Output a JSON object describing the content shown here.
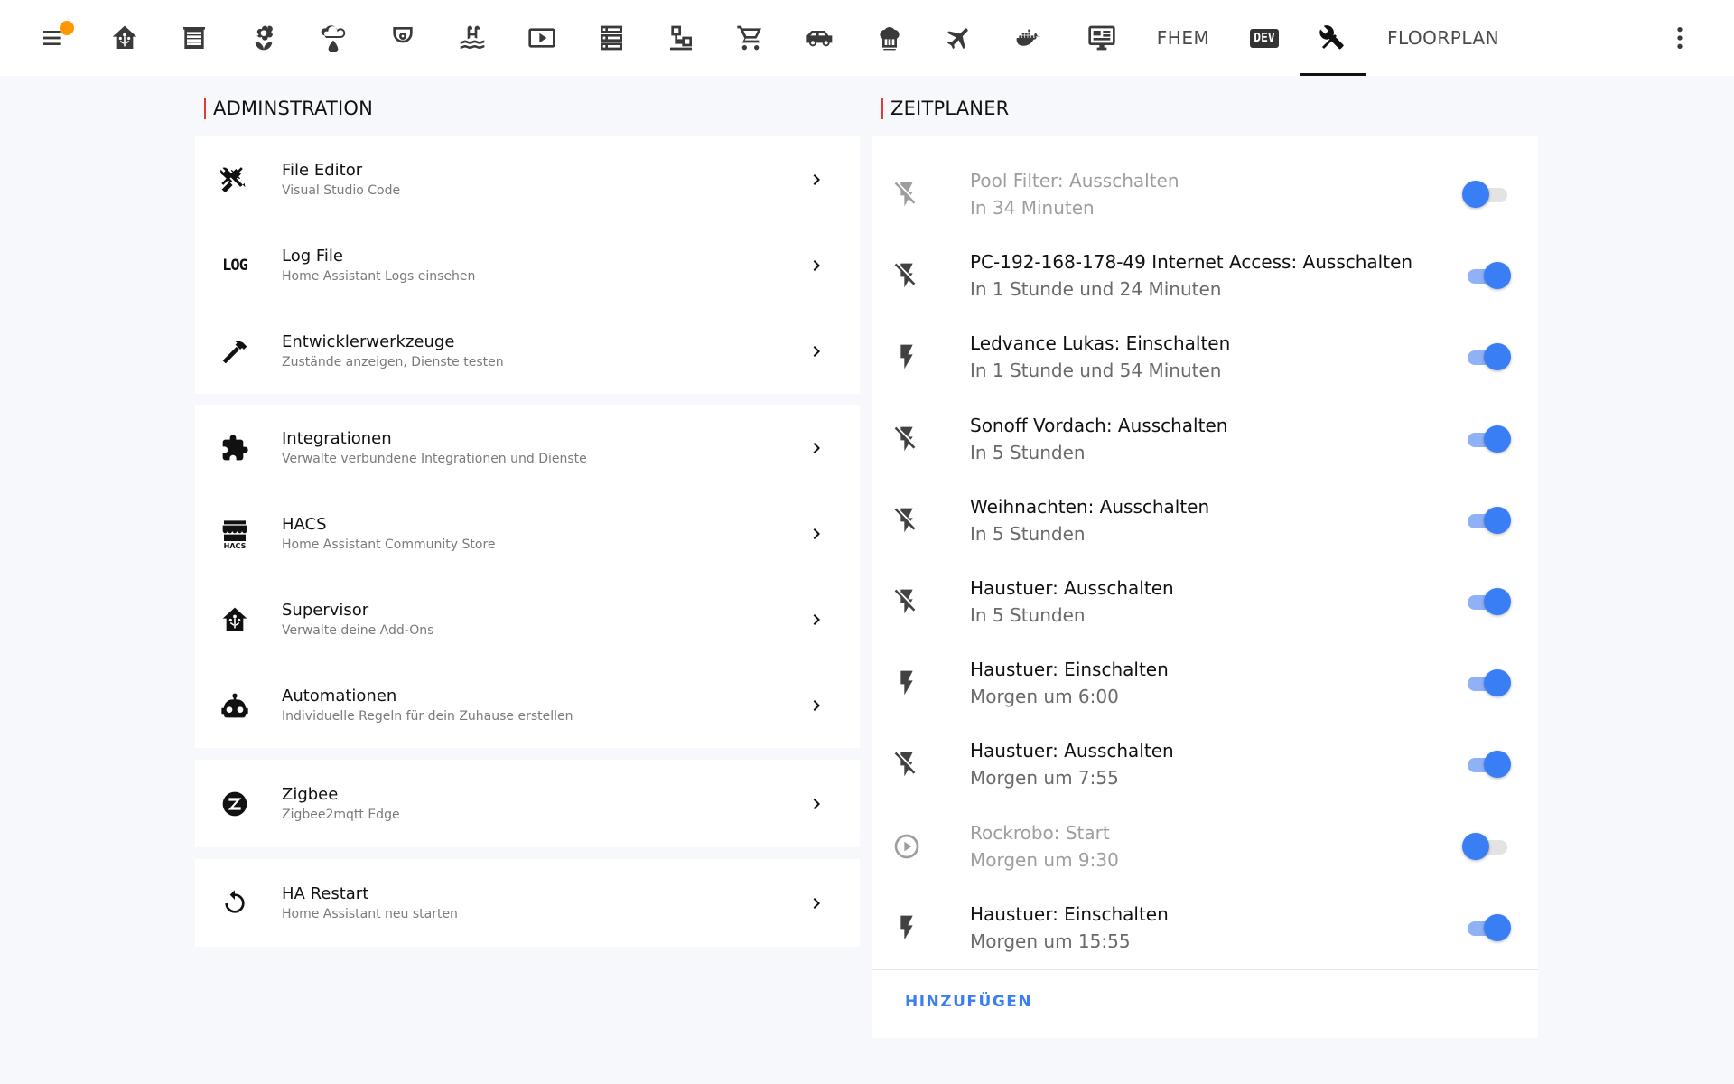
{
  "topbar": {
    "tabs": [
      {
        "icon": "menu-icon"
      },
      {
        "icon": "home-assistant-icon"
      },
      {
        "icon": "garage-icon"
      },
      {
        "icon": "flower-icon"
      },
      {
        "icon": "sprinkler-icon"
      },
      {
        "icon": "camera-dome-icon"
      },
      {
        "icon": "pool-icon"
      },
      {
        "icon": "play-box-icon"
      },
      {
        "icon": "server-icon"
      },
      {
        "icon": "lan-icon"
      },
      {
        "icon": "cart-icon"
      },
      {
        "icon": "car-icon"
      },
      {
        "icon": "chef-hat-icon"
      },
      {
        "icon": "airplane-icon"
      },
      {
        "icon": "docker-icon"
      },
      {
        "icon": "monitor-dashboard-icon"
      }
    ],
    "fhem_label": "FHEM",
    "dev_label": "DEV",
    "floorplan_label": "FLOORPLAN",
    "active_tab": "tools",
    "notification_color": "#ff9800"
  },
  "admin": {
    "title": "ADMINSTRATION",
    "groups": [
      [
        {
          "title": "File Editor",
          "subtitle": "Visual Studio Code",
          "icon": "tools-icon"
        },
        {
          "title": "Log File",
          "subtitle": "Home Assistant Logs einsehen",
          "icon": "log-icon",
          "icon_text": "LOG"
        },
        {
          "title": "Entwicklerwerkzeuge",
          "subtitle": "Zustände anzeigen, Dienste testen",
          "icon": "hammer-icon"
        }
      ],
      [
        {
          "title": "Integrationen",
          "subtitle": "Verwalte verbundene Integrationen und Dienste",
          "icon": "puzzle-icon"
        },
        {
          "title": "HACS",
          "subtitle": "Home Assistant Community Store",
          "icon": "hacs-icon",
          "icon_text": "HACS"
        },
        {
          "title": "Supervisor",
          "subtitle": "Verwalte deine Add-Ons",
          "icon": "home-assistant-icon"
        },
        {
          "title": "Automationen",
          "subtitle": "Individuelle Regeln für dein Zuhause erstellen",
          "icon": "robot-icon"
        }
      ],
      [
        {
          "title": "Zigbee",
          "subtitle": "Zigbee2mqtt Edge",
          "icon": "zigbee-icon"
        }
      ],
      [
        {
          "title": "HA Restart",
          "subtitle": "Home Assistant neu starten",
          "icon": "restart-icon"
        }
      ]
    ]
  },
  "scheduler": {
    "title": "ZEITPLANER",
    "add_label": "HINZUFÜGEN",
    "accent_color": "#3a7ef5",
    "items": [
      {
        "title": "Pool Filter: Ausschalten",
        "when": "In 34 Minuten",
        "icon": "flash-off-icon",
        "enabled": false
      },
      {
        "title": "PC-192-168-178-49 Internet Access: Ausschalten",
        "when": "In 1 Stunde und 24 Minuten",
        "icon": "flash-off-icon",
        "enabled": true
      },
      {
        "title": "Ledvance Lukas: Einschalten",
        "when": "In 1 Stunde und 54 Minuten",
        "icon": "flash-icon",
        "enabled": true
      },
      {
        "title": "Sonoff Vordach: Ausschalten",
        "when": "In 5 Stunden",
        "icon": "flash-off-icon",
        "enabled": true
      },
      {
        "title": "Weihnachten: Ausschalten",
        "when": "In 5 Stunden",
        "icon": "flash-off-icon",
        "enabled": true
      },
      {
        "title": "Haustuer: Ausschalten",
        "when": "In 5 Stunden",
        "icon": "flash-off-icon",
        "enabled": true
      },
      {
        "title": "Haustuer: Einschalten",
        "when": "Morgen um 6:00",
        "icon": "flash-icon",
        "enabled": true
      },
      {
        "title": "Haustuer: Ausschalten",
        "when": "Morgen um 7:55",
        "icon": "flash-off-icon",
        "enabled": true
      },
      {
        "title": "Rockrobo: Start",
        "when": "Morgen um 9:30",
        "icon": "play-circle-icon",
        "enabled": false
      },
      {
        "title": "Haustuer: Einschalten",
        "when": "Morgen um 15:55",
        "icon": "flash-icon",
        "enabled": true
      }
    ]
  }
}
